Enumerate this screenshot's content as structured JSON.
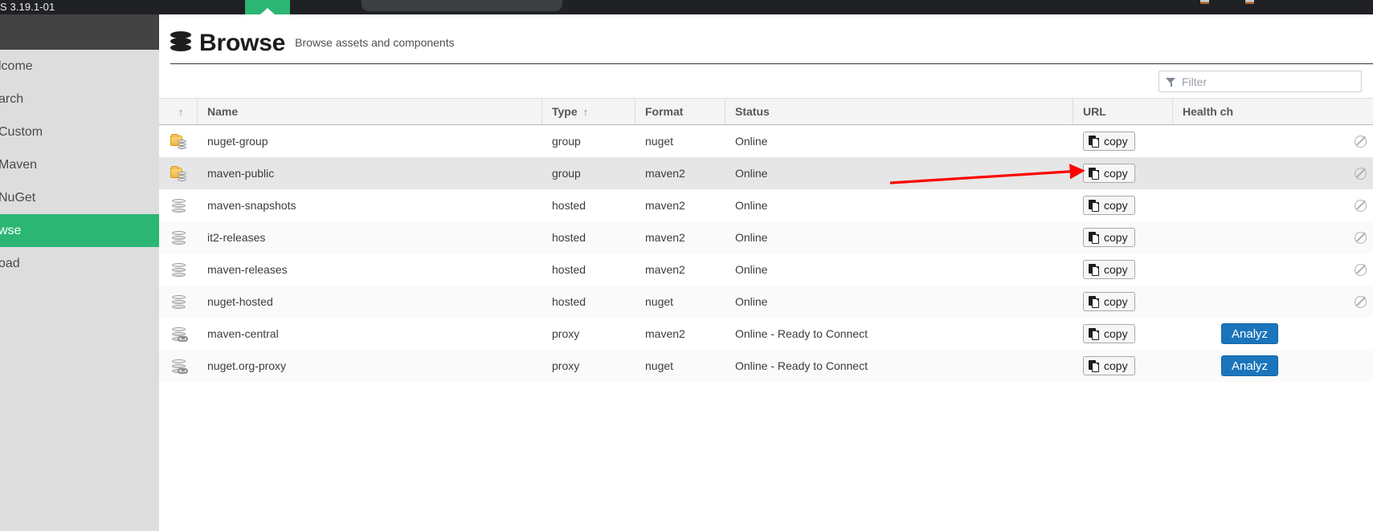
{
  "window": {
    "title": "S 3.19.1-01",
    "browser_tab_color": "#2bb673"
  },
  "sidebar": {
    "items": [
      {
        "label": "lcome",
        "name": "welcome",
        "selected": false
      },
      {
        "label": "arch",
        "name": "search",
        "selected": false
      },
      {
        "label": "Custom",
        "name": "search-custom",
        "selected": false
      },
      {
        "label": "Maven",
        "name": "search-maven",
        "selected": false
      },
      {
        "label": "NuGet",
        "name": "search-nuget",
        "selected": false
      },
      {
        "label": "wse",
        "name": "browse",
        "selected": true
      },
      {
        "label": "oad",
        "name": "upload",
        "selected": false
      }
    ],
    "selected_color": "#2bb673"
  },
  "header": {
    "title": "Browse",
    "subtitle": "Browse assets and components",
    "icon": "database-icon"
  },
  "filter": {
    "placeholder": "Filter",
    "value": "",
    "icon": "funnel-icon"
  },
  "table": {
    "columns": [
      {
        "key": "icon",
        "label": "",
        "sorted": "asc"
      },
      {
        "key": "name",
        "label": "Name",
        "sorted": null
      },
      {
        "key": "type",
        "label": "Type",
        "sorted": "asc"
      },
      {
        "key": "format",
        "label": "Format",
        "sorted": null
      },
      {
        "key": "status",
        "label": "Status",
        "sorted": null
      },
      {
        "key": "url",
        "label": "URL",
        "sorted": null
      },
      {
        "key": "health",
        "label": "Health ch",
        "sorted": null
      }
    ],
    "copy_label": "copy",
    "analyze_label": "Analyz",
    "rows": [
      {
        "icon": "group-repository-icon",
        "name": "nuget-group",
        "type": "group",
        "format": "nuget",
        "status": "Online",
        "url": "copy",
        "health": "disabled"
      },
      {
        "icon": "group-repository-icon",
        "name": "maven-public",
        "type": "group",
        "format": "maven2",
        "status": "Online",
        "url": "copy",
        "health": "disabled"
      },
      {
        "icon": "hosted-repository-icon",
        "name": "maven-snapshots",
        "type": "hosted",
        "format": "maven2",
        "status": "Online",
        "url": "copy",
        "health": "disabled"
      },
      {
        "icon": "hosted-repository-icon",
        "name": "it2-releases",
        "type": "hosted",
        "format": "maven2",
        "status": "Online",
        "url": "copy",
        "health": "disabled"
      },
      {
        "icon": "hosted-repository-icon",
        "name": "maven-releases",
        "type": "hosted",
        "format": "maven2",
        "status": "Online",
        "url": "copy",
        "health": "disabled"
      },
      {
        "icon": "hosted-repository-icon",
        "name": "nuget-hosted",
        "type": "hosted",
        "format": "nuget",
        "status": "Online",
        "url": "copy",
        "health": "disabled"
      },
      {
        "icon": "proxy-repository-icon",
        "name": "maven-central",
        "type": "proxy",
        "format": "maven2",
        "status": "Online - Ready to Connect",
        "url": "copy",
        "health": "analyze"
      },
      {
        "icon": "proxy-repository-icon",
        "name": "nuget.org-proxy",
        "type": "proxy",
        "format": "nuget",
        "status": "Online - Ready to Connect",
        "url": "copy",
        "health": "analyze"
      }
    ],
    "highlighted_row_index": 1
  },
  "annotation": {
    "type": "arrow",
    "color": "#ff0000",
    "points_to": "copy-button-row-maven-public"
  }
}
